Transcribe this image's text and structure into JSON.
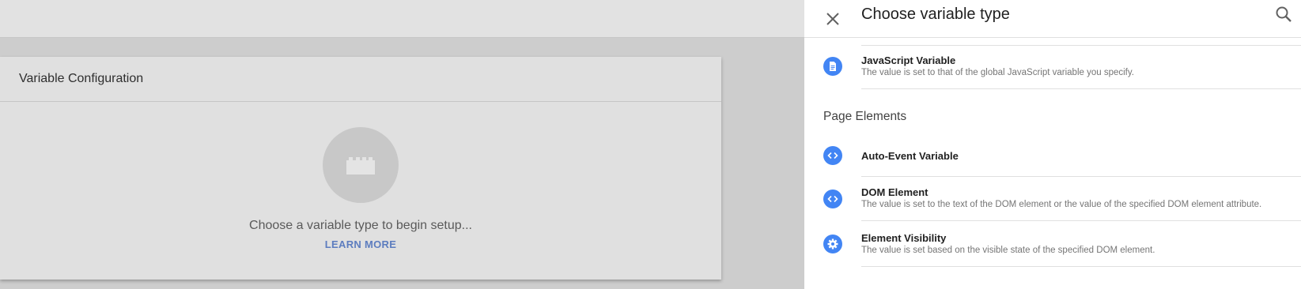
{
  "background": {
    "card_title": "Variable Configuration",
    "empty_text": "Choose a variable type to begin setup...",
    "learn_more": "LEARN MORE",
    "placeholder_icon": "lego-brick-icon"
  },
  "panel": {
    "title": "Choose variable type",
    "close_icon": "close-icon",
    "search_icon": "search-icon",
    "items_top": [
      {
        "name": "JavaScript Variable",
        "description": "The value is set to that of the global JavaScript variable you specify.",
        "icon": "document-icon"
      }
    ],
    "section": {
      "title": "Page Elements",
      "items": [
        {
          "name": "Auto-Event Variable",
          "description": "",
          "icon": "code-icon"
        },
        {
          "name": "DOM Element",
          "description": "The value is set to the text of the DOM element or the value of the specified DOM element attribute.",
          "icon": "code-icon"
        },
        {
          "name": "Element Visibility",
          "description": "The value is set based on the visible state of the specified DOM element.",
          "icon": "gear-icon"
        }
      ]
    }
  },
  "colors": {
    "accent": "#4285f4",
    "link": "#5d7dbf",
    "overlay": "#cdcdcd"
  }
}
